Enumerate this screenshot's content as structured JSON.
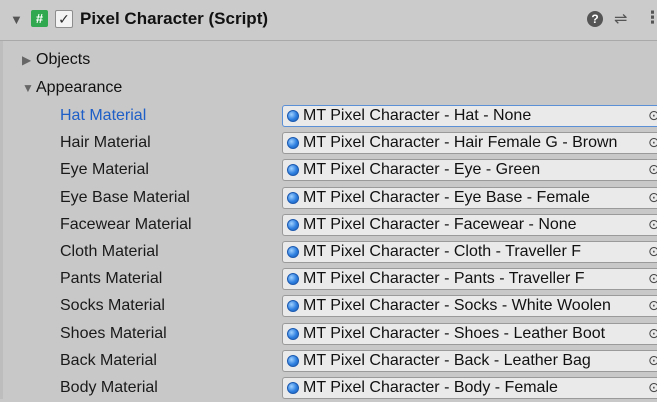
{
  "header": {
    "title": "Pixel Character (Script)",
    "hash_glyph": "#",
    "check_glyph": "✓",
    "help_glyph": "?",
    "settings_glyph": "⇌",
    "more_glyph": "⋮"
  },
  "sections": {
    "objects": "Objects",
    "appearance": "Appearance"
  },
  "materials": [
    {
      "label": "Hat Material",
      "value": "MT Pixel Character - Hat - None"
    },
    {
      "label": "Hair Material",
      "value": "MT Pixel Character - Hair Female G - Brown"
    },
    {
      "label": "Eye Material",
      "value": "MT Pixel Character - Eye - Green"
    },
    {
      "label": "Eye Base Material",
      "value": "MT Pixel Character - Eye Base - Female"
    },
    {
      "label": "Facewear Material",
      "value": "MT Pixel Character - Facewear - None"
    },
    {
      "label": "Cloth Material",
      "value": "MT Pixel Character - Cloth - Traveller F"
    },
    {
      "label": "Pants Material",
      "value": "MT Pixel Character - Pants - Traveller F"
    },
    {
      "label": "Socks Material",
      "value": "MT Pixel Character - Socks - White Woolen"
    },
    {
      "label": "Shoes Material",
      "value": "MT Pixel Character - Shoes - Leather Boot"
    },
    {
      "label": "Back Material",
      "value": "MT Pixel Character - Back - Leather Bag"
    },
    {
      "label": "Body Material",
      "value": "MT Pixel Character - Body - Female"
    }
  ],
  "picker_glyph": "⊙",
  "colors": {
    "selected_label": "#1d5ec7",
    "component_icon": "#2fa84f",
    "object_dot": "#2d7fe0"
  }
}
